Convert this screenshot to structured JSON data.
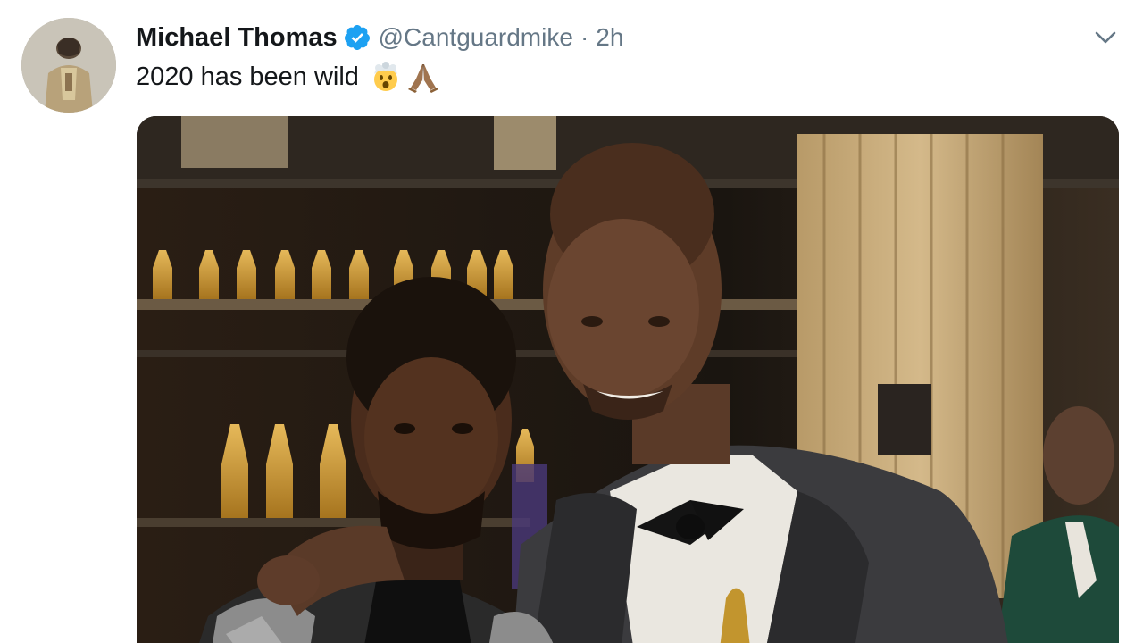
{
  "tweet": {
    "display_name": "Michael Thomas",
    "handle": "@Cantguardmike",
    "separator": "·",
    "time": "2h",
    "text": "2020 has been wild",
    "emojis": [
      "exploding-head-emoji",
      "folded-hands-emoji"
    ],
    "verified": true,
    "icons": {
      "verified": "verified-badge-icon",
      "menu": "chevron-down-icon"
    },
    "colors": {
      "name": "#14171a",
      "meta": "#657786",
      "verified": "#1da1f2"
    }
  }
}
